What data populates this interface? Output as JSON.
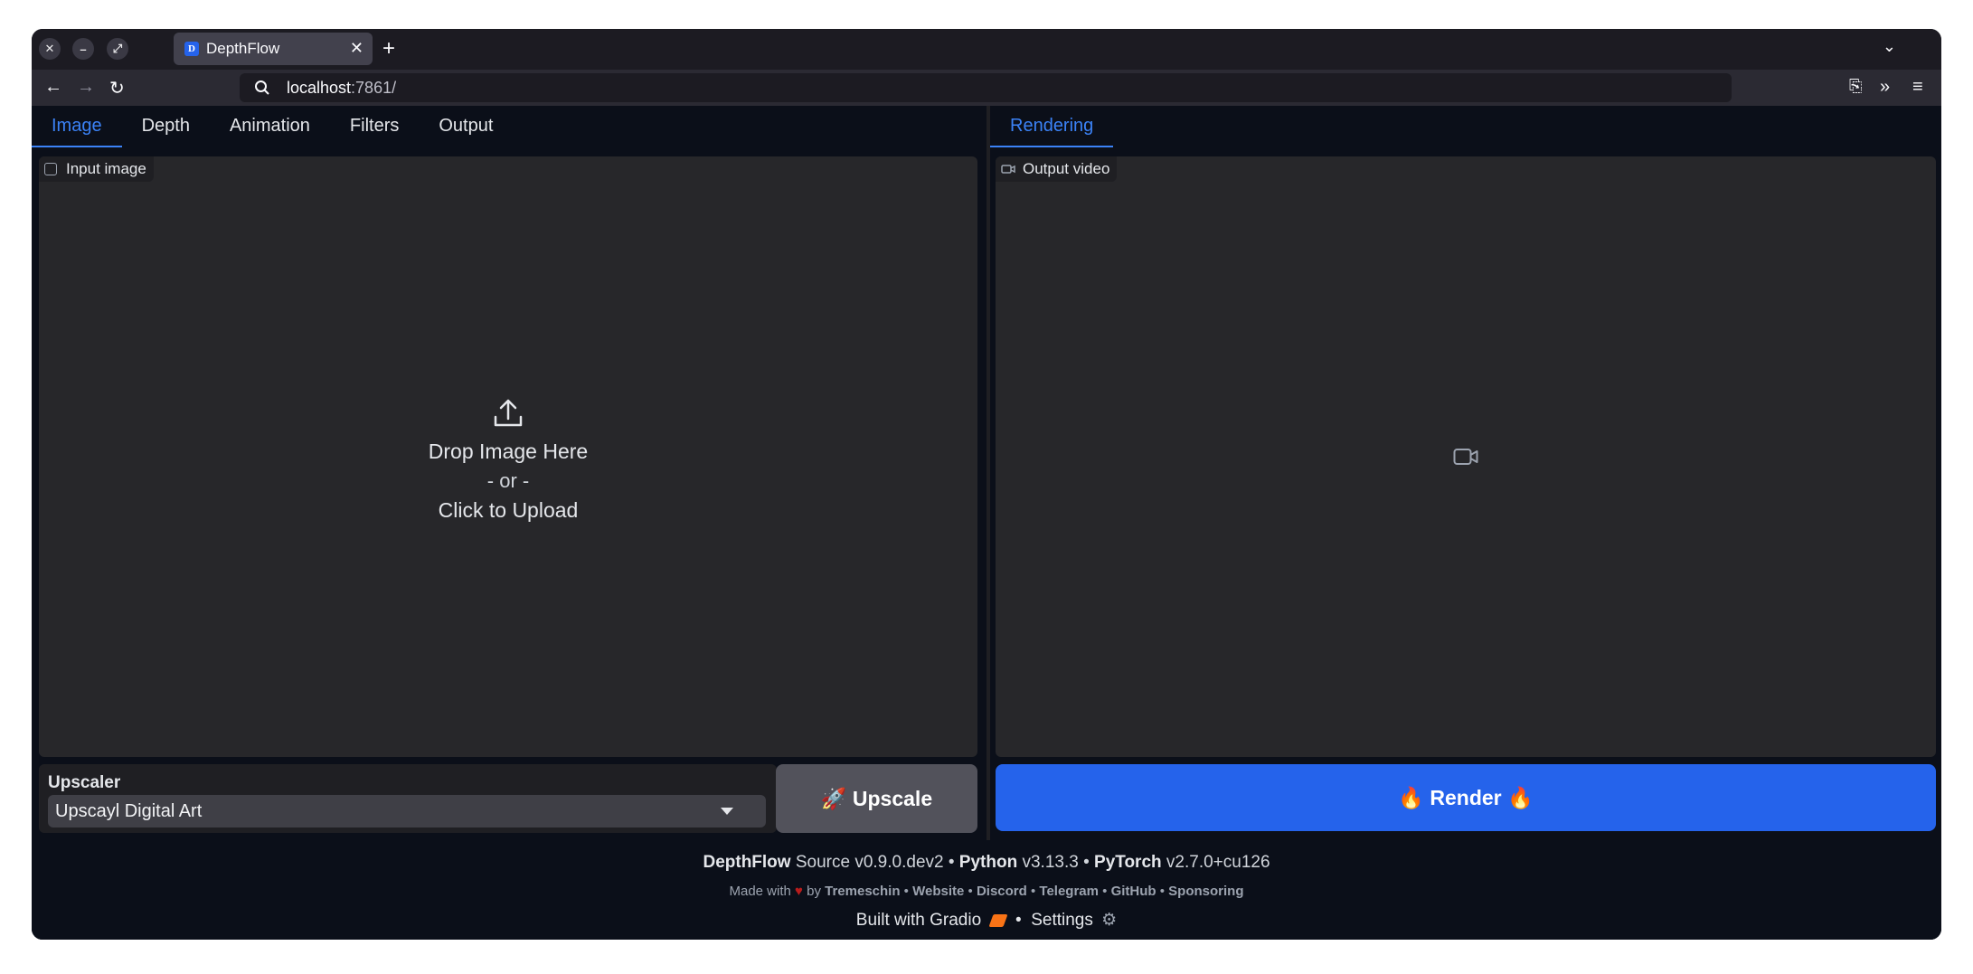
{
  "browser": {
    "tab_title": "DepthFlow",
    "tab_favicon": "D",
    "url_host": "localhost",
    "url_port": ":7861/"
  },
  "left": {
    "tabs": [
      "Image",
      "Depth",
      "Animation",
      "Filters",
      "Output"
    ],
    "input_label": "Input image",
    "drop_text": "Drop Image Here",
    "or_text": "- or -",
    "click_text": "Click to Upload",
    "upscaler_label": "Upscaler",
    "upscaler_value": "Upscayl Digital Art",
    "upscale_button": "🚀 Upscale"
  },
  "right": {
    "tab": "Rendering",
    "output_label": "Output video",
    "render_button": "🔥 Render 🔥"
  },
  "footer": {
    "app_name": "DepthFlow",
    "app_version": "Source v0.9.0.dev2",
    "python_label": "Python",
    "python_version": "v3.13.3",
    "torch_label": "PyTorch",
    "torch_version": "v2.7.0+cu126",
    "made_with": "Made with",
    "by": "by",
    "links": [
      "Tremeschin",
      "Website",
      "Discord",
      "Telegram",
      "GitHub",
      "Sponsoring"
    ],
    "built_with": "Built with Gradio",
    "settings": "Settings"
  },
  "colors": {
    "accent": "#3b82f6",
    "render_bg": "#2563eb",
    "app_bg": "#0b0f19"
  }
}
